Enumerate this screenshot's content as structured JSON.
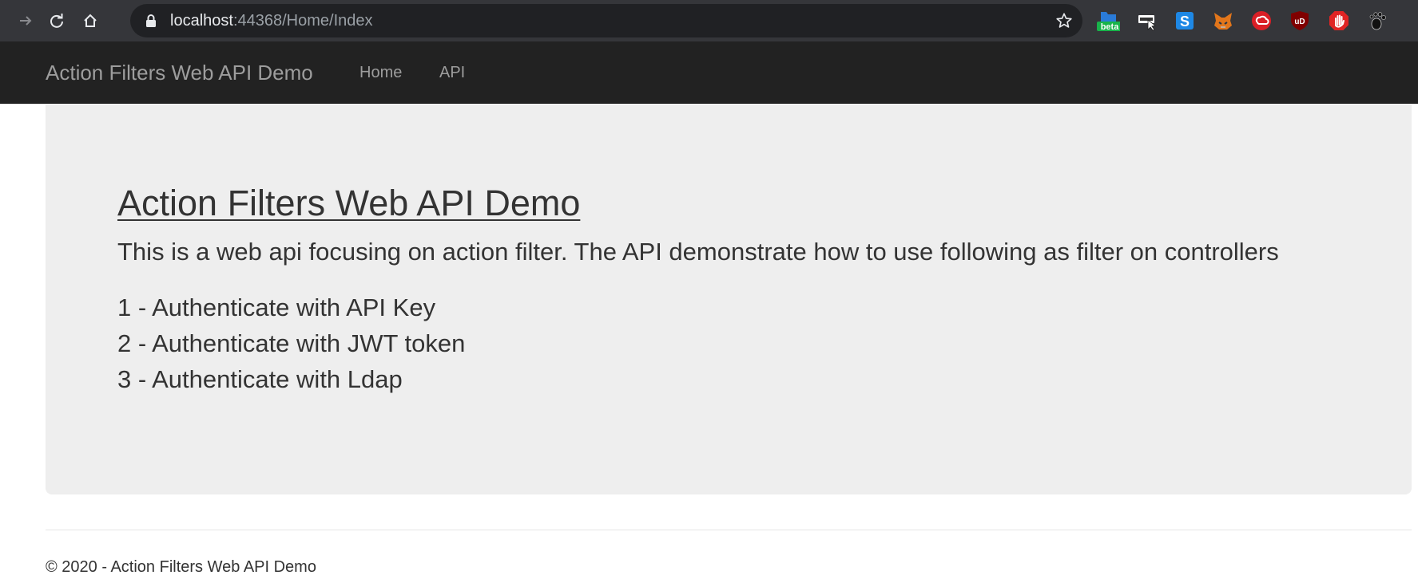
{
  "browser": {
    "url_host": "localhost",
    "url_rest": ":44368/Home/Index",
    "extensions": [
      {
        "name": "beta-folder-extension-icon",
        "badge": "beta"
      },
      {
        "name": "pdf-extension-icon"
      },
      {
        "name": "skype-extension-icon",
        "glyph": "S"
      },
      {
        "name": "metamask-fox-icon"
      },
      {
        "name": "adobe-cloud-icon"
      },
      {
        "name": "ublock-origin-icon",
        "glyph": "uD"
      },
      {
        "name": "stop-hand-icon"
      },
      {
        "name": "gnome-foot-icon"
      }
    ],
    "colors": {
      "frame": "#35363a",
      "omnibox": "#202124"
    }
  },
  "navbar": {
    "brand": "Action Filters Web API Demo",
    "links": [
      {
        "label": "Home"
      },
      {
        "label": "API"
      }
    ]
  },
  "jumbotron": {
    "title": "Action Filters Web API Demo",
    "lead": "This is a web api focusing on action filter. The API demonstrate how to use following as filter on controllers",
    "items": [
      "1 - Authenticate with API Key",
      "2 - Authenticate with JWT token",
      "3 - Authenticate with Ldap"
    ]
  },
  "footer": {
    "text": "© 2020 - Action Filters Web API Demo"
  }
}
